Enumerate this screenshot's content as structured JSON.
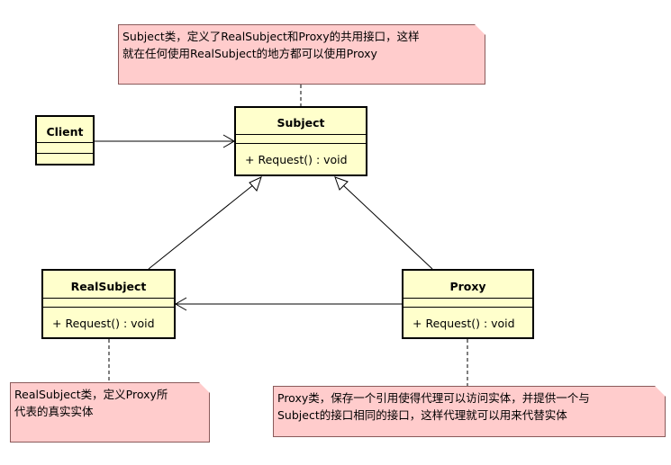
{
  "notes": {
    "subject": {
      "lines": [
        "Subject类，定义了RealSubject和Proxy的共用接口，这样",
        "就在任何使用RealSubject的地方都可以使用Proxy"
      ]
    },
    "realsubject": {
      "lines": [
        "RealSubject类，定义Proxy所",
        "代表的真实实体"
      ]
    },
    "proxy": {
      "lines": [
        "Proxy类，保存一个引用使得代理可以访问实体，并提供一个与",
        "Subject的接口相同的接口，这样代理就可以用来代替实体"
      ]
    }
  },
  "classes": {
    "client": {
      "name": "Client"
    },
    "subject": {
      "name": "Subject",
      "operation": "+ Request() : void"
    },
    "realsubject": {
      "name": "RealSubject",
      "operation": "+ Request() : void"
    },
    "proxy": {
      "name": "Proxy",
      "operation": "+ Request() : void"
    }
  },
  "colors": {
    "class_fill": "#ffffcc",
    "note_fill": "#ffcccc",
    "line": "#000000"
  }
}
